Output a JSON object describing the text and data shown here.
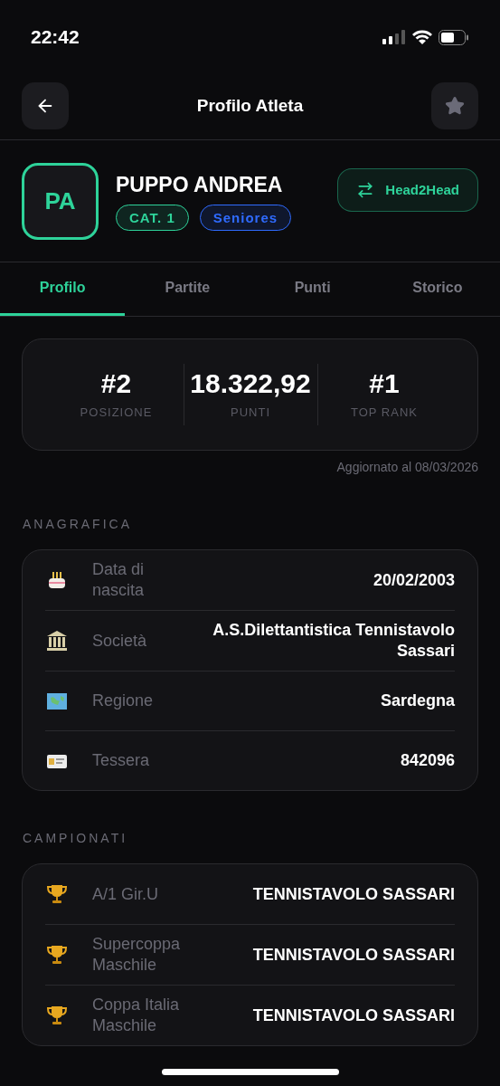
{
  "status_bar": {
    "time": "22:42"
  },
  "header": {
    "title": "Profilo Atleta",
    "favorite": false
  },
  "athlete": {
    "initials": "PA",
    "name": "PUPPO ANDREA",
    "badges": [
      {
        "label": "CAT. 1",
        "color": "#2ed39a"
      },
      {
        "label": "Seniores",
        "color": "#2f6bff"
      }
    ],
    "action": "Head2Head"
  },
  "tabs": [
    {
      "label": "Profilo",
      "selected": true
    },
    {
      "label": "Partite",
      "selected": false
    },
    {
      "label": "Punti",
      "selected": false
    },
    {
      "label": "Storico",
      "selected": false
    }
  ],
  "stats": [
    {
      "value": "#2",
      "label": "POSIZIONE"
    },
    {
      "value": "18.322,92",
      "label": "PUNTI"
    },
    {
      "value": "#1",
      "label": "TOP RANK"
    }
  ],
  "updated": "Aggiornato al 08/03/2026",
  "sections": [
    {
      "title": "ANAGRAFICA",
      "rows": [
        {
          "kind": "cake",
          "label": "Data di nascita",
          "value": "20/02/2003"
        },
        {
          "kind": "building",
          "label": "Società",
          "value": "A.S.Dilettantistica Tennistavolo Sassari"
        },
        {
          "kind": "map",
          "label": "Regione",
          "value": "Sardegna"
        },
        {
          "kind": "card",
          "label": "Tessera",
          "value": "842096"
        }
      ]
    },
    {
      "title": "CAMPIONATI",
      "rows": [
        {
          "kind": "trophy",
          "label": "A/1 Gir.U",
          "value": "TENNISTAVOLO SASSARI"
        },
        {
          "kind": "trophy",
          "label": "Supercoppa Maschile",
          "value": "TENNISTAVOLO SASSARI"
        },
        {
          "kind": "trophy",
          "label": "Coppa Italia Maschile",
          "value": "TENNISTAVOLO SASSARI"
        }
      ]
    }
  ]
}
